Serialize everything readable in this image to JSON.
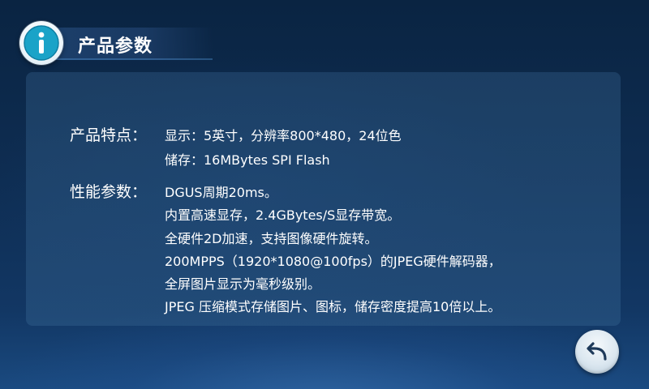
{
  "header": {
    "title": "产品参数",
    "icon": "info-icon",
    "accent_color": "#1aa3c8"
  },
  "specs": {
    "features": {
      "label": "产品特点：",
      "lines": [
        "显示：5英寸，分辨率800*480，24位色",
        "储存：16MBytes SPI Flash"
      ]
    },
    "performance": {
      "label": "性能参数：",
      "lines": [
        "DGUS周期20ms。",
        "内置高速显存，2.4GBytes/S显存带宽。",
        "全硬件2D加速，支持图像硬件旋转。",
        "200MPPS（1920*1080@100fps）的JPEG硬件解码器，",
        "全屏图片显示为毫秒级别。",
        "JPEG 压缩模式存储图片、图标，储存密度提高10倍以上。"
      ]
    }
  },
  "back_button": {
    "icon": "back-arrow-icon"
  }
}
